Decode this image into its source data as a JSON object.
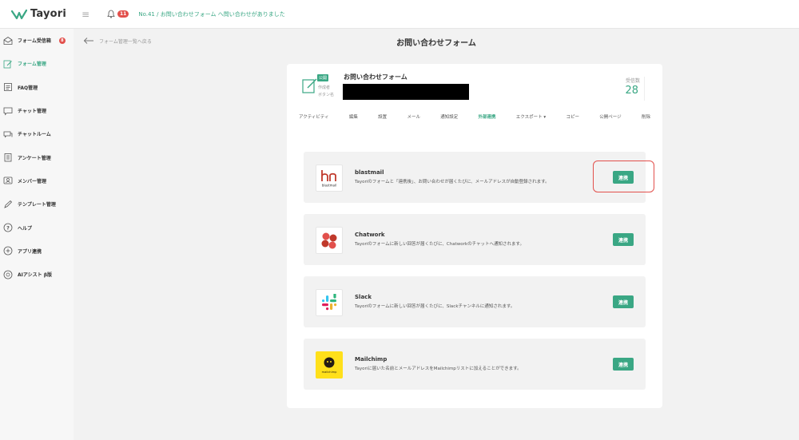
{
  "header": {
    "logo": "Tayori",
    "bell_count": "11",
    "notice": "No.41 / お問い合わせフォーム へ問い合わせがありました"
  },
  "sidebar": {
    "items": [
      {
        "label": "フォーム受信箱",
        "icon": "inbox-icon",
        "badge": "8"
      },
      {
        "label": "フォーム管理",
        "icon": "form-edit-icon",
        "active": true
      },
      {
        "label": "FAQ管理",
        "icon": "faq-icon"
      },
      {
        "label": "チャット管理",
        "icon": "chat-icon"
      },
      {
        "label": "チャットルーム",
        "icon": "chatroom-icon"
      },
      {
        "label": "アンケート管理",
        "icon": "survey-icon"
      },
      {
        "label": "メンバー管理",
        "icon": "members-icon"
      },
      {
        "label": "テンプレート管理",
        "icon": "template-icon"
      },
      {
        "label": "ヘルプ",
        "icon": "help-icon"
      },
      {
        "label": "アプリ連携",
        "icon": "app-plus-icon"
      },
      {
        "label": "AIアシスト β版",
        "icon": "ai-assist-icon"
      }
    ]
  },
  "main": {
    "back_label": "フォーム管理一覧へ戻る",
    "page_title": "お問い合わせフォーム"
  },
  "form": {
    "badge": "公開",
    "name": "お問い合わせフォーム",
    "creator_label": "作成者",
    "button_label": "ボタン名",
    "count_label": "受信数",
    "count_value": "28",
    "tabs": [
      "アクティビティ",
      "編集",
      "設置",
      "メール",
      "通知設定",
      "外部連携",
      "エクスポート ▾",
      "コピー",
      "公開ページ",
      "削除"
    ],
    "active_tab": "外部連携"
  },
  "integrations": [
    {
      "name": "blastmail",
      "logo": "blastmail-logo",
      "logo_caption": "blastmail",
      "desc": "Tayoriのフォームと「連携後」、お問い合わせが届くたびに、メールアドレスが自動登録されます。",
      "button": "連携",
      "color": "#c0392b"
    },
    {
      "name": "Chatwork",
      "logo": "chatwork-logo",
      "desc": "Tayoriのフォームに新しい回答が届くたびに、Chatworkのチャットへ通知されます。",
      "button": "連携",
      "color": "#e2504c"
    },
    {
      "name": "Slack",
      "logo": "slack-logo",
      "desc": "Tayoriのフォームに新しい回答が届くたびに、Slackチャンネルに通知されます。",
      "button": "連携"
    },
    {
      "name": "Mailchimp",
      "logo": "mailchimp-logo",
      "logo_caption": "mailchimp",
      "desc": "Tayoriに届いた名前とメールアドレスをMailchimpリストに加えることができます。",
      "button": "連携",
      "color": "#ffe01b"
    }
  ],
  "colors": {
    "accent": "#3aa784",
    "alert": "#e2504c"
  }
}
